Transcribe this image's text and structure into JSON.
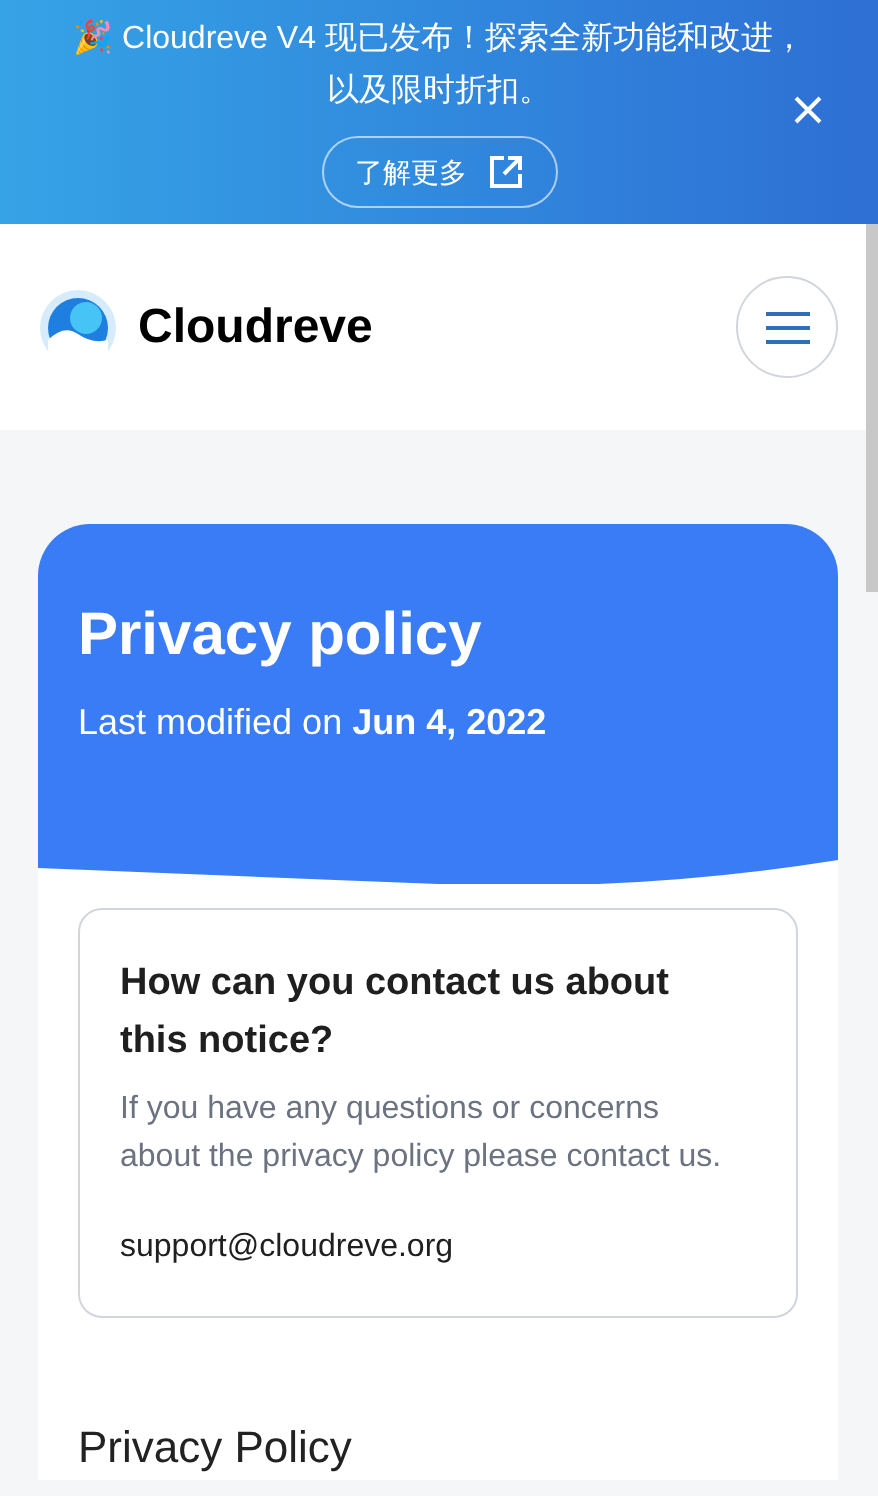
{
  "banner": {
    "message": "🎉 Cloudreve V4 现已发布！探索全新功能和改进，以及限时折扣。",
    "button": "了解更多"
  },
  "header": {
    "brand": "Cloudreve"
  },
  "hero": {
    "title": "Privacy policy",
    "subtitle": "Last modified on **Jun 4, 2022**"
  },
  "contact": {
    "heading": "How can you contact us about this notice?",
    "text": "If you have any questions or concerns about the privacy policy please contact us.",
    "email": "support@cloudreve.org"
  },
  "section_title": "Privacy Policy"
}
